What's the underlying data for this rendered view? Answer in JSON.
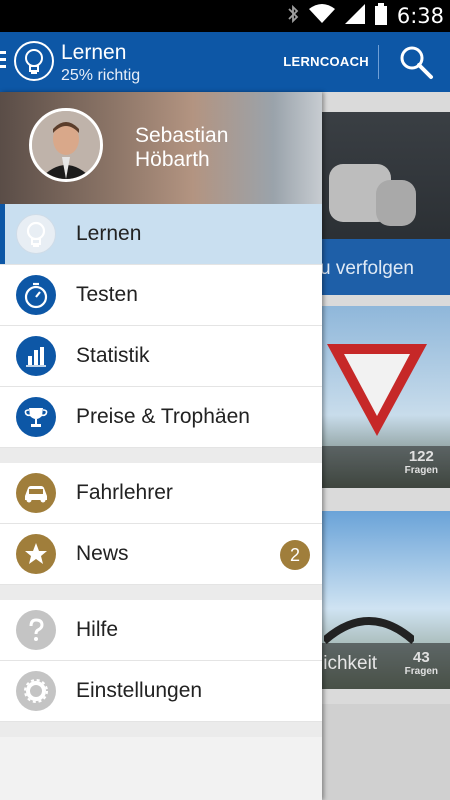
{
  "statusbar": {
    "time": "6:38"
  },
  "appbar": {
    "title": "Lernen",
    "subtitle": "25% richtig",
    "action_label": "LERNCOACH"
  },
  "profile": {
    "first_name": "Sebastian",
    "last_name": "Höbarth"
  },
  "nav": {
    "group1": [
      {
        "label": "Lernen",
        "icon": "lightbulb-icon",
        "active": true
      },
      {
        "label": "Testen",
        "icon": "stopwatch-icon"
      },
      {
        "label": "Statistik",
        "icon": "bar-chart-icon"
      },
      {
        "label": "Preise & Trophäen",
        "icon": "trophy-icon"
      }
    ],
    "group2": [
      {
        "label": "Fahrlehrer",
        "icon": "car-icon"
      },
      {
        "label": "News",
        "icon": "star-icon",
        "badge": "2"
      }
    ],
    "group3": [
      {
        "label": "Hilfe",
        "icon": "question-icon"
      },
      {
        "label": "Einstellungen",
        "icon": "gear-icon"
      }
    ]
  },
  "background_cards": [
    {
      "caption": "u verfolgen"
    },
    {
      "count": "122",
      "count_label": "Fragen"
    },
    {
      "caption": "lichkeit",
      "count": "43",
      "count_label": "Fragen"
    }
  ],
  "colors": {
    "primary": "#0d57a6",
    "gold": "#a07e3b",
    "grey_icon": "#c4c4c4",
    "active_row": "#c9dff0"
  }
}
